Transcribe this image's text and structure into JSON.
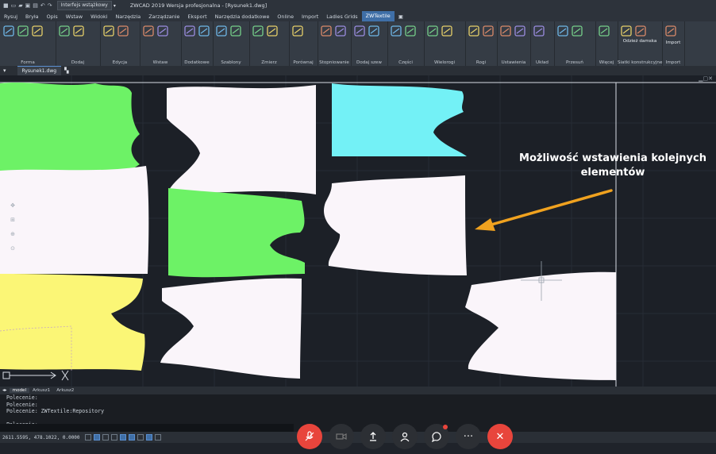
{
  "window": {
    "workspace": "Interfejs wstążkowy",
    "title": "ZWCAD 2019 Wersja profesjonalna - [Rysunek1.dwg]"
  },
  "menu": [
    "Rysuj",
    "Bryła",
    "Opis",
    "Wstaw",
    "Widoki",
    "Narzędzia",
    "Zarządzanie",
    "Eksport",
    "Narzędzia dodatkowe",
    "Online",
    "Import",
    "Ladies Grids",
    "ZWTextile"
  ],
  "menu_active": "ZWTextile",
  "ribbon_groups": [
    "Forma",
    "Dodaj",
    "Edycja",
    "Wstaw",
    "Dodatkowe",
    "Szablony",
    "Zmierz",
    "Porównaj",
    "Stopniowanie",
    "Dodaj szew",
    "Części",
    "Wielorogi",
    "Rogi",
    "Ustawienia",
    "Układ",
    "Przesuń",
    "Więcej",
    "Siatki konstrukcyjne",
    "Import"
  ],
  "ribbon_big_buttons": {
    "odziez": "Odzież damska",
    "import": "Import"
  },
  "document_tab": "Rysunek1.dwg",
  "annotation": {
    "line1": "Możliwość wstawienia kolejnych",
    "line2": "elementów"
  },
  "layout_tabs": [
    "model",
    "Arkusz1",
    "Arkusz2"
  ],
  "layout_active": "model",
  "command_history": [
    "Polecenie:",
    "Polecenie:",
    "Polecenie: ZWTextile:Repository",
    "",
    "Polecenie:"
  ],
  "coordinates": "2611.5595, 478.1022, 0.0000",
  "colors": {
    "green": "#6df266",
    "cyan": "#73f1f6",
    "yellow": "#fbf676",
    "white": "#faf5fa",
    "arrow": "#f0a21f",
    "accent": "#3f6fa7",
    "meeting_red": "#e8453c"
  },
  "meeting_controls": {
    "mic_icon": "mic-off-icon",
    "video_icon": "video-off-icon",
    "share_icon": "share-upload-icon",
    "people_icon": "participants-icon",
    "chat_icon": "chat-icon",
    "more_icon": "more-icon",
    "leave_icon": "close-icon",
    "more_label": "···",
    "leave_label": "✕"
  }
}
